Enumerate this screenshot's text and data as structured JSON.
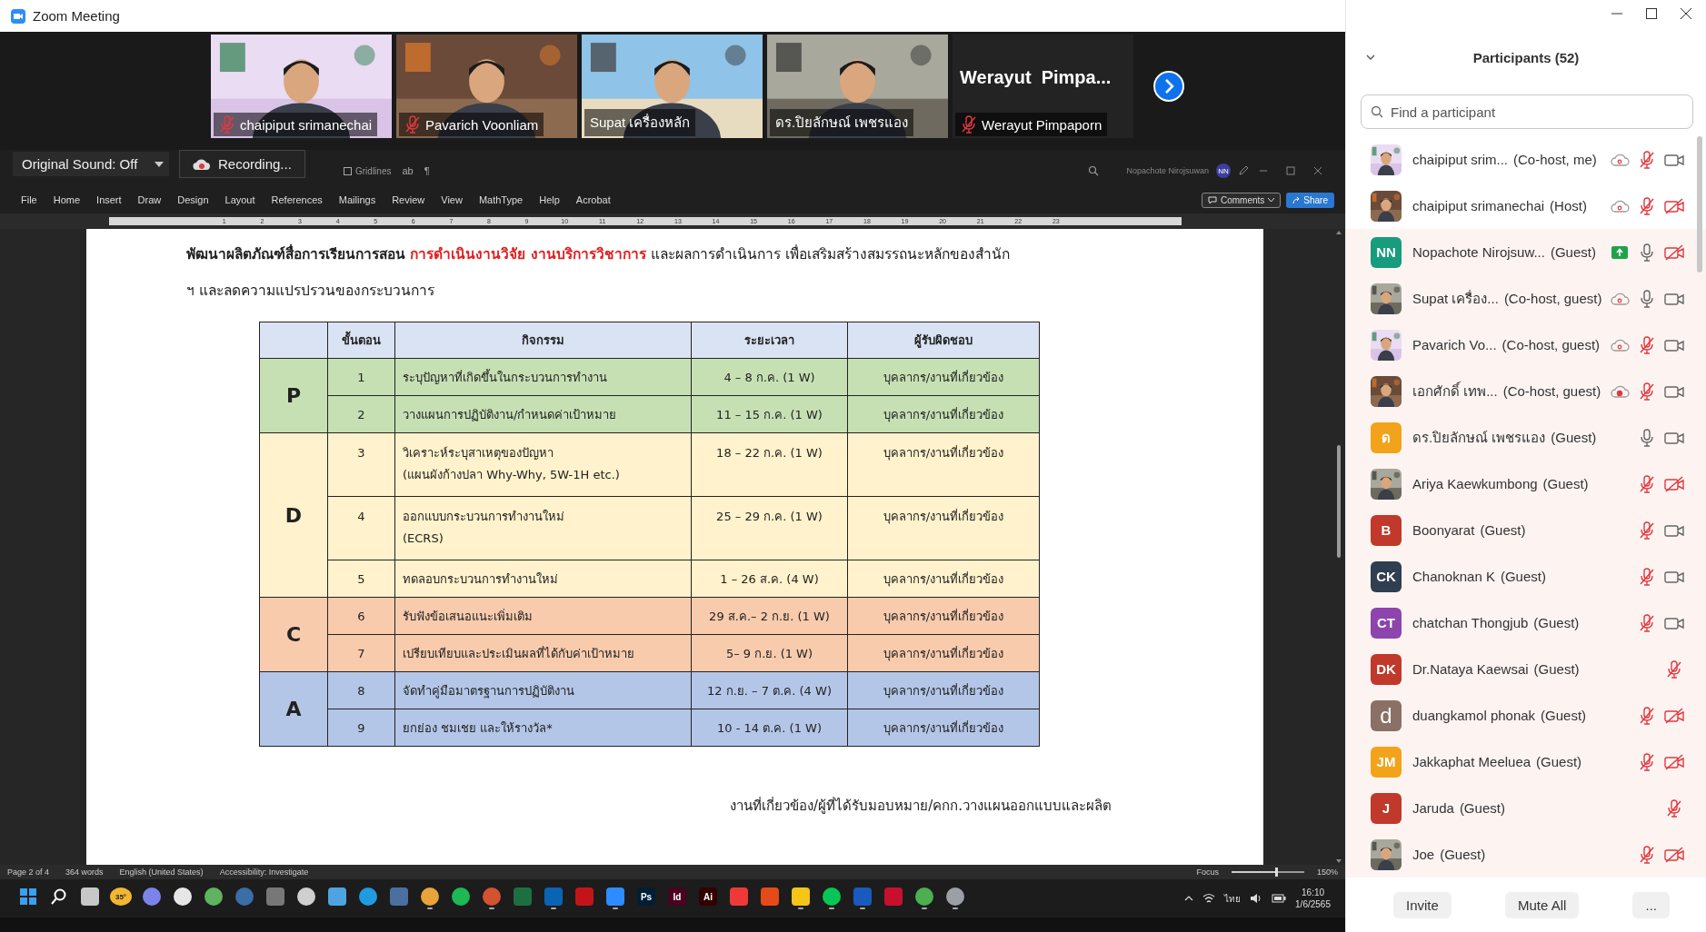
{
  "window": {
    "title": "Zoom Meeting"
  },
  "video_tiles": [
    {
      "kind": "video",
      "name": "chaipiput srimanechai",
      "muted": true
    },
    {
      "kind": "video",
      "name": "Pavarich Voonliam",
      "muted": true
    },
    {
      "kind": "video",
      "name": "Supat เครื่องหลัก",
      "muted": false
    },
    {
      "kind": "video",
      "name": "ดร.ปิยลักษณ์ เพชรแอง",
      "muted": false
    },
    {
      "kind": "name_only",
      "display_name": "Werayut  Pimpa...",
      "name": "Werayut Pimpaporn",
      "muted": true
    }
  ],
  "audio_menu": {
    "label": "Original Sound: Off"
  },
  "recording": {
    "label": "Recording..."
  },
  "word": {
    "gridlines": {
      "label": "Gridlines",
      "checked": false
    },
    "toolbar_glyphs": [
      "ab",
      "¶"
    ],
    "account_name": "Nopachote Nirojsuwan",
    "account_initials": "NN",
    "menu": [
      "File",
      "Home",
      "Insert",
      "Draw",
      "Design",
      "Layout",
      "References",
      "Mailings",
      "Review",
      "View",
      "MathType",
      "Help",
      "Acrobat"
    ],
    "comments_button": "Comments",
    "share_button": "Share",
    "ruler": [
      "1",
      "2",
      "3",
      "4",
      "5",
      "6",
      "7",
      "8",
      "9",
      "10",
      "11",
      "12",
      "13",
      "14",
      "15",
      "16",
      "17",
      "18",
      "19",
      "20",
      "21",
      "22",
      "23"
    ],
    "document": {
      "paragraphs": [
        [
          {
            "kind": "bold",
            "text": "พัฒนาผลิตภัณฑ์สื่อการเรียนการสอน "
          },
          {
            "kind": "red",
            "text": "การดำเนินงานวิจัย งานบริการวิชาการ"
          },
          {
            "kind": "plain",
            "text": " และผลการดำเนินการ เพื่อเสริมสร้างสมรรถนะหลักของสำนัก"
          }
        ],
        [
          {
            "kind": "plain",
            "text": "ฯ และลดความแปรปรวนของกระบวนการ"
          }
        ]
      ],
      "table": {
        "columns": [
          "ขั้นตอน",
          "กิจกรรม",
          "ระยะเวลา",
          "ผู้รับผิดชอบ"
        ],
        "groups": [
          {
            "phase": "P",
            "color": "#c6e0b4",
            "rows": [
              {
                "step": "1",
                "activity": "ระบุปัญหาที่เกิดขึ้นในกระบวนการทำงาน",
                "period": "4 – 8 ก.ค. (1 W)",
                "owner": "บุคลากร/งานที่เกี่ยวข้อง"
              },
              {
                "step": "2",
                "activity": "วางแผนการปฏิบัติงาน/กำหนดค่าเป้าหมาย",
                "period": "11 – 15 ก.ค. (1 W)",
                "owner": "บุคลากร/งานที่เกี่ยวข้อง"
              }
            ]
          },
          {
            "phase": "D",
            "color": "#fff2cc",
            "rows": [
              {
                "step": "3",
                "activity": "วิเคราะห์ระบุสาเหตุของปัญหา\n(แผนผังก้างปลา Why-Why, 5W-1H etc.)",
                "period": "18 – 22 ก.ค. (1 W)",
                "owner": "บุคลากร/งานที่เกี่ยวข้อง"
              },
              {
                "step": "4",
                "activity": "ออกแบบกระบวนการทำงานใหม่\n(ECRS)",
                "period": "25 – 29 ก.ค. (1 W)",
                "owner": "บุคลากร/งานที่เกี่ยวข้อง"
              },
              {
                "step": "5",
                "activity": "ทดลอบกระบวนการทำงานใหม่",
                "period": "1 – 26 ส.ค. (4 W)",
                "owner": "บุคลากร/งานที่เกี่ยวข้อง"
              }
            ]
          },
          {
            "phase": "C",
            "color": "#f8cbad",
            "rows": [
              {
                "step": "6",
                "activity": "รับฟังข้อเสนอแนะเพิ่มเติม",
                "period": "29 ส.ค.– 2 ก.ย. (1 W)",
                "owner": "บุคลากร/งานที่เกี่ยวข้อง"
              },
              {
                "step": "7",
                "activity": "เปรียบเทียบและประเมินผลที่ได้กับค่าเป้าหมาย",
                "period": "5– 9 ก.ย. (1 W)",
                "owner": "บุคลากร/งานที่เกี่ยวข้อง"
              }
            ]
          },
          {
            "phase": "A",
            "color": "#b4c6e7",
            "rows": [
              {
                "step": "8",
                "activity": "จัดทำคู่มือมาตรฐานการปฏิบัติงาน",
                "period": "12 ก.ย. – 7 ต.ค. (4 W)",
                "owner": "บุคลากร/งานที่เกี่ยวข้อง"
              },
              {
                "step": "9",
                "activity": "ยกย่อง ชมเชย และให้รางวัล*",
                "period": "10 - 14 ต.ค. (1 W)",
                "owner": "บุคลากร/งานที่เกี่ยวข้อง"
              }
            ]
          }
        ]
      },
      "footer": "งานที่เกี่ยวข้อง/ผู้ที่ได้รับมอบหมาย/คกก.วางแผนออกแบบและผลิต"
    },
    "status_bar": {
      "page": "Page 2 of 4",
      "words": "364 words",
      "language": "English (United States)",
      "accessibility": "Accessibility: Investigate",
      "focus": "Focus",
      "zoom": "150%",
      "zoom_slider": {
        "level": 0.6
      }
    }
  },
  "taskbar": {
    "apps": [
      {
        "kind": "windows",
        "color": "#3aa0f0",
        "open": false
      },
      {
        "kind": "search",
        "color": "#ffffff",
        "open": false
      },
      {
        "kind": "square",
        "color": "#c8c8c8",
        "open": false
      },
      {
        "kind": "weather",
        "color": "#f2b632",
        "label": "35°",
        "open": false
      },
      {
        "kind": "circle",
        "color": "#7b83eb",
        "open": false
      },
      {
        "kind": "circle",
        "color": "#e6e6e6",
        "open": false
      },
      {
        "kind": "circle",
        "color": "#5fb25f",
        "open": false
      },
      {
        "kind": "circle",
        "color": "#3a6ea5",
        "open": false
      },
      {
        "kind": "square",
        "color": "#777777",
        "open": false
      },
      {
        "kind": "circle",
        "color": "#cfcfcf",
        "open": false
      },
      {
        "kind": "square",
        "color": "#4fa3e0",
        "open": false
      },
      {
        "kind": "circle",
        "color": "#1f9be0",
        "open": false
      },
      {
        "kind": "square",
        "color": "#4a6fa0",
        "open": false
      },
      {
        "kind": "circle",
        "color": "#e8a33a",
        "open": true
      },
      {
        "kind": "circle",
        "color": "#1db954",
        "open": false
      },
      {
        "kind": "circle",
        "color": "#d35230",
        "open": true
      },
      {
        "kind": "square",
        "color": "#1d6f42",
        "open": false
      },
      {
        "kind": "square",
        "color": "#0a64b4",
        "open": true
      },
      {
        "kind": "square",
        "color": "#c4141b",
        "open": false
      },
      {
        "kind": "square",
        "color": "#2d8cff",
        "open": true
      },
      {
        "kind": "square",
        "color": "#001e36",
        "label": "Ps",
        "open": false
      },
      {
        "kind": "square",
        "color": "#49021f",
        "label": "Id",
        "open": false
      },
      {
        "kind": "square",
        "color": "#330000",
        "label": "Ai",
        "open": false
      },
      {
        "kind": "square",
        "color": "#ef3939",
        "open": false
      },
      {
        "kind": "square",
        "color": "#e64a19",
        "open": false
      },
      {
        "kind": "square",
        "color": "#f5c518",
        "open": true
      },
      {
        "kind": "circle",
        "color": "#06c755",
        "open": true
      },
      {
        "kind": "square",
        "color": "#185abd",
        "open": true
      },
      {
        "kind": "square",
        "color": "#c8102e",
        "open": false
      },
      {
        "kind": "circle",
        "color": "#4caf50",
        "open": true
      },
      {
        "kind": "circle",
        "color": "#9aa0a6",
        "open": true
      }
    ],
    "language": "ไทย",
    "time": "16:10",
    "date": "1/6/2565"
  },
  "participants_panel": {
    "title": "Participants (52)",
    "search": {
      "placeholder": "Find a participant"
    },
    "participants": [
      {
        "name": "chaipiput srim...",
        "role": "(Co-host, me)",
        "highlighted": false,
        "cloud": true,
        "cloud_recording": false,
        "sharing": false,
        "muted": true,
        "camera": true,
        "video_on": true
      },
      {
        "name": "chaipiput srimanechai",
        "role": "(Host)",
        "highlighted": false,
        "cloud": true,
        "cloud_recording": false,
        "sharing": false,
        "muted": true,
        "camera": true,
        "video_on": false
      },
      {
        "name": "Nopachote Nirojsuw...",
        "role": "(Guest)",
        "avatar": {
          "kind": "initials",
          "initials": "NN",
          "color": "#179c7d"
        },
        "highlighted": true,
        "cloud": false,
        "sharing": true,
        "muted": false,
        "camera": true,
        "video_on": false
      },
      {
        "name": "Supat เครื่อง...",
        "role": "(Co-host, guest)",
        "highlighted": true,
        "cloud": true,
        "cloud_recording": false,
        "sharing": false,
        "muted": false,
        "camera": true,
        "video_on": true
      },
      {
        "name": "Pavarich Vo...",
        "role": "(Co-host, guest)",
        "highlighted": true,
        "cloud": true,
        "cloud_recording": false,
        "sharing": false,
        "muted": true,
        "camera": true,
        "video_on": true
      },
      {
        "name": "เอกศักดิ์ เทพ...",
        "role": "(Co-host, guest)",
        "highlighted": true,
        "cloud": true,
        "cloud_recording": true,
        "sharing": false,
        "muted": true,
        "camera": true,
        "video_on": true
      },
      {
        "name": "ดร.ปิยลักษณ์ เพชรแอง",
        "role": "(Guest)",
        "avatar": {
          "kind": "initials",
          "initials": "ด",
          "color": "#f2a31b"
        },
        "highlighted": true,
        "cloud": false,
        "sharing": false,
        "muted": false,
        "camera": true,
        "video_on": true
      },
      {
        "name": "Ariya Kaewkumbong",
        "role": "(Guest)",
        "highlighted": true,
        "cloud": false,
        "sharing": false,
        "muted": true,
        "camera": true,
        "video_on": false
      },
      {
        "name": "Boonyarat",
        "role": "(Guest)",
        "avatar": {
          "kind": "initials",
          "initials": "B",
          "color": "#c0392b"
        },
        "highlighted": true,
        "cloud": false,
        "sharing": false,
        "muted": true,
        "camera": true,
        "video_on": true
      },
      {
        "name": "Chanoknan K",
        "role": "(Guest)",
        "avatar": {
          "kind": "initials",
          "initials": "CK",
          "color": "#2f3e50"
        },
        "highlighted": true,
        "cloud": false,
        "sharing": false,
        "muted": true,
        "camera": true,
        "video_on": true
      },
      {
        "name": "chatchan Thongjub",
        "role": "(Guest)",
        "avatar": {
          "kind": "initials",
          "initials": "CT",
          "color": "#8e44ad"
        },
        "highlighted": true,
        "cloud": false,
        "sharing": false,
        "muted": true,
        "camera": true,
        "video_on": true
      },
      {
        "name": "Dr.Nataya Kaewsai",
        "role": "(Guest)",
        "avatar": {
          "kind": "initials",
          "initials": "DK",
          "color": "#c0392b"
        },
        "highlighted": true,
        "cloud": false,
        "sharing": false,
        "muted": true,
        "camera": false
      },
      {
        "name": "duangkamol phonak",
        "role": "(Guest)",
        "avatar": {
          "kind": "initials",
          "initials": "d",
          "color": "#8a7065"
        },
        "highlighted": true,
        "cloud": false,
        "sharing": false,
        "muted": true,
        "camera": true,
        "video_on": false
      },
      {
        "name": "Jakkaphat Meeluea",
        "role": "(Guest)",
        "avatar": {
          "kind": "initials",
          "initials": "JM",
          "color": "#f2a31b"
        },
        "highlighted": true,
        "cloud": false,
        "sharing": false,
        "muted": true,
        "camera": true,
        "video_on": false
      },
      {
        "name": "Jaruda",
        "role": "(Guest)",
        "avatar": {
          "kind": "initials",
          "initials": "J",
          "color": "#c0392b"
        },
        "highlighted": true,
        "cloud": false,
        "sharing": false,
        "muted": true,
        "camera": false
      },
      {
        "name": "Joe",
        "role": "(Guest)",
        "highlighted": true,
        "cloud": false,
        "sharing": false,
        "muted": true,
        "camera": true,
        "video_on": false
      }
    ],
    "buttons": [
      "Invite",
      "Mute All",
      "..."
    ]
  }
}
